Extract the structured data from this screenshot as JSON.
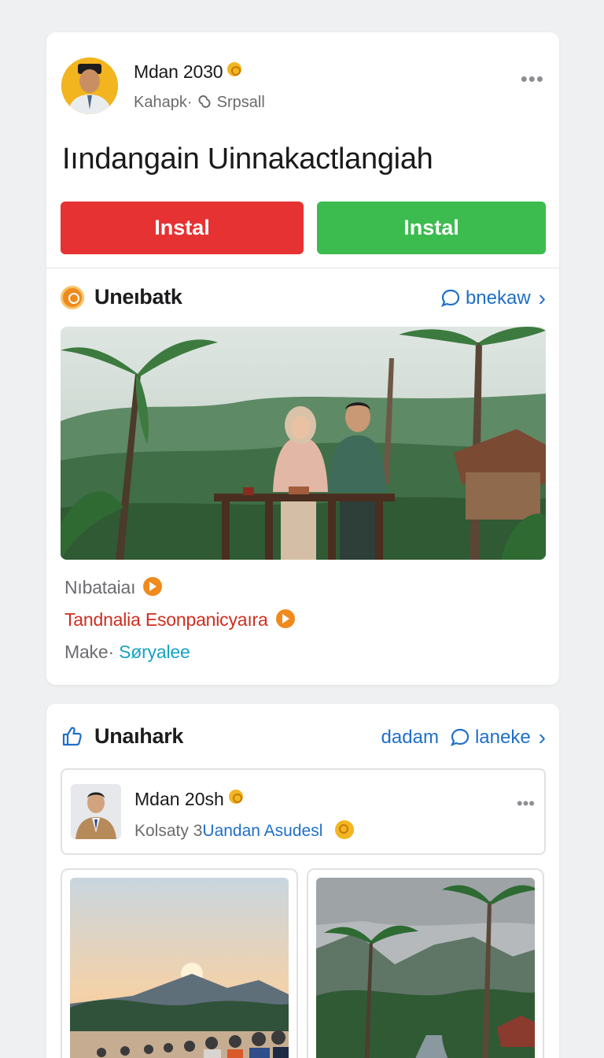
{
  "post": {
    "author_name": "Mdan 2030",
    "author_sub": "Kahapk· ",
    "author_sub_icon": "link-icon",
    "author_sub_tail": "Srpsall",
    "title": "Iındangain Uinnakactlangiah",
    "btn_left": "Instal",
    "btn_right": "Instal",
    "colors": {
      "red": "#e63232",
      "green": "#3cbb4f"
    }
  },
  "section1": {
    "title": "Uneıbatk",
    "link": "bnekaw",
    "meta_1": "Nıbataiaı",
    "meta_2": "Tandnalia Esonpanicyaıra",
    "meta_3_prefix": "Make·",
    "meta_3_link": "Søryalee"
  },
  "section2": {
    "title": "Unaıhark",
    "link_a": "dadam",
    "link_b": "laneke",
    "mini_post": {
      "name": "Mdan 20sh",
      "sub_prefix": "Kolsaty",
      "sub_number": "3",
      "sub_link": "Uandan Asudesl"
    }
  }
}
